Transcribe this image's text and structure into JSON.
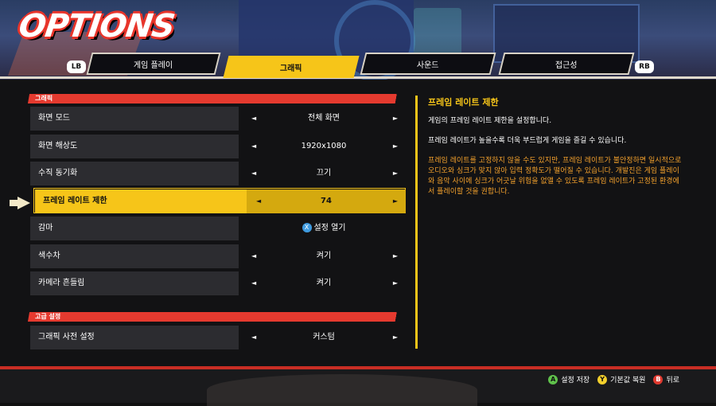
{
  "header": {
    "logo_text": "OPTIONS"
  },
  "tabs": {
    "left_shoulder": "LB",
    "right_shoulder": "RB",
    "items": [
      {
        "label": "게임 플레이",
        "active": false
      },
      {
        "label": "그래픽",
        "active": true
      },
      {
        "label": "사운드",
        "active": false
      },
      {
        "label": "접근성",
        "active": false
      }
    ]
  },
  "sections": {
    "graphics": "그래픽",
    "advanced": "고급 설정"
  },
  "rows": {
    "display_mode": {
      "label": "화면 모드",
      "value": "전체 화면"
    },
    "resolution": {
      "label": "화면 해상도",
      "value": "1920x1080"
    },
    "vsync": {
      "label": "수직 동기화",
      "value": "끄기"
    },
    "frame_limit": {
      "label": "프레임 레이트 제한",
      "value": "74"
    },
    "gamma": {
      "label": "감마",
      "button_glyph": "X",
      "value": "설정 열기"
    },
    "chromatic": {
      "label": "색수차",
      "value": "켜기"
    },
    "camera_shake": {
      "label": "카메라 흔들림",
      "value": "켜기"
    },
    "preset": {
      "label": "그래픽 사전 설정",
      "value": "커스텀"
    }
  },
  "arrows": {
    "left": "◄",
    "right": "►"
  },
  "description": {
    "title": "프레임 레이트 제한",
    "line1": "게임의 프레임 레이트 제한을 설정합니다.",
    "line2": "프레임 레이트가 높을수록 더욱 부드럽게 게임을 즐길 수 있습니다.",
    "warning": "프레임 레이트를 고정하지 않을 수도 있지만, 프레임 레이트가 불안정하면 일시적으로 오디오와 싱크가 맞지 않아 입력 정확도가 떨어질 수 있습니다. 개발진은 게임 플레이와 음악 사이에 싱크가 어긋날 위험을 없앨 수 있도록 프레임 레이트가 고정된 환경에서 플레이할 것을 권합니다."
  },
  "hints": [
    {
      "glyph": "A",
      "label": "설정 저장"
    },
    {
      "glyph": "Y",
      "label": "기본값 복원"
    },
    {
      "glyph": "B",
      "label": "뒤로"
    }
  ],
  "colors": {
    "accent": "#f6c519",
    "section_red": "#e53a2f",
    "warning": "#f4a12c"
  }
}
